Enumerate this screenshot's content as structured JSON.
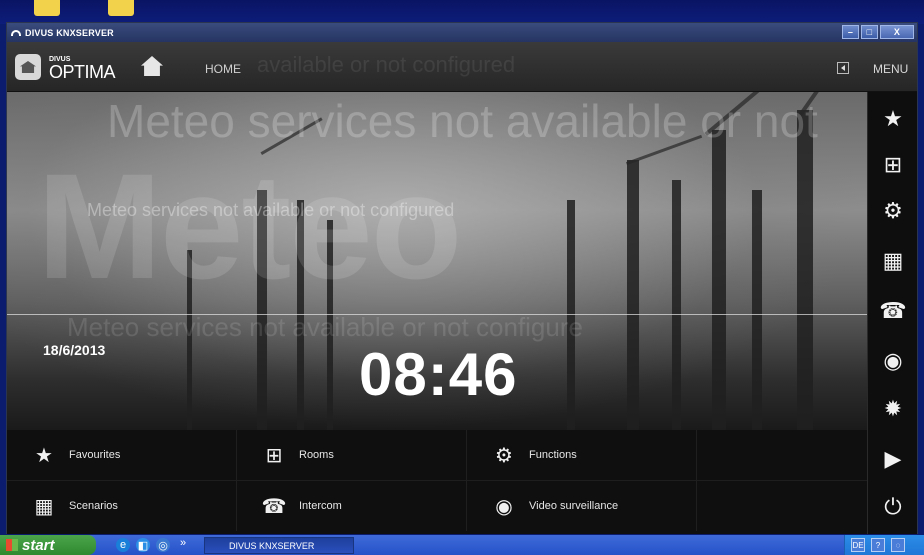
{
  "window": {
    "title": "DIVUS KNXSERVER",
    "min_label": "–",
    "max_label": "□",
    "close_label": "X"
  },
  "app": {
    "logo_small": "DIVUS",
    "logo_big": "OPTIMA",
    "breadcrumb": "HOME",
    "breadcrumb_ghost": "available or not configured",
    "menu_label": "MENU"
  },
  "hero": {
    "ghost_huge": "Meteo",
    "ghost_big": "Meteo services not available or not",
    "ghost_med": "Meteo services not available or not configured",
    "ghost_low": "Meteo services not available or not configure",
    "date": "18/6/2013",
    "time": "08:46"
  },
  "tiles": [
    {
      "label": "Favourites",
      "icon": "star-icon",
      "glyph": "★"
    },
    {
      "label": "Rooms",
      "icon": "rooms-icon",
      "glyph": "⊞"
    },
    {
      "label": "Functions",
      "icon": "gears-icon",
      "glyph": "⚙"
    },
    {
      "label": "Scenarios",
      "icon": "scenarios-icon",
      "glyph": "▦"
    },
    {
      "label": "Intercom",
      "icon": "intercom-icon",
      "glyph": "☎"
    },
    {
      "label": "Video surveillance",
      "icon": "camera-icon",
      "glyph": "◉"
    }
  ],
  "sidebar": [
    {
      "icon": "star-icon",
      "glyph": "★"
    },
    {
      "icon": "rooms-icon",
      "glyph": "⊞"
    },
    {
      "icon": "gears-icon",
      "glyph": "⚙"
    },
    {
      "icon": "scenarios-icon",
      "glyph": "▦"
    },
    {
      "icon": "intercom-icon",
      "glyph": "☎"
    },
    {
      "icon": "camera-icon",
      "glyph": "◉"
    },
    {
      "icon": "alarm-icon",
      "glyph": "✹"
    },
    {
      "icon": "media-icon",
      "glyph": "▶"
    },
    {
      "icon": "power-icon",
      "glyph": "⏻"
    }
  ],
  "taskbar": {
    "start_label": "start",
    "task_label": "DIVUS KNXSERVER",
    "tray_lang": "DE",
    "more_label": "»"
  },
  "colors": {
    "titlebar": "#2f3f70",
    "taskbar": "#2f5fd0",
    "start": "#3c9a3c"
  }
}
